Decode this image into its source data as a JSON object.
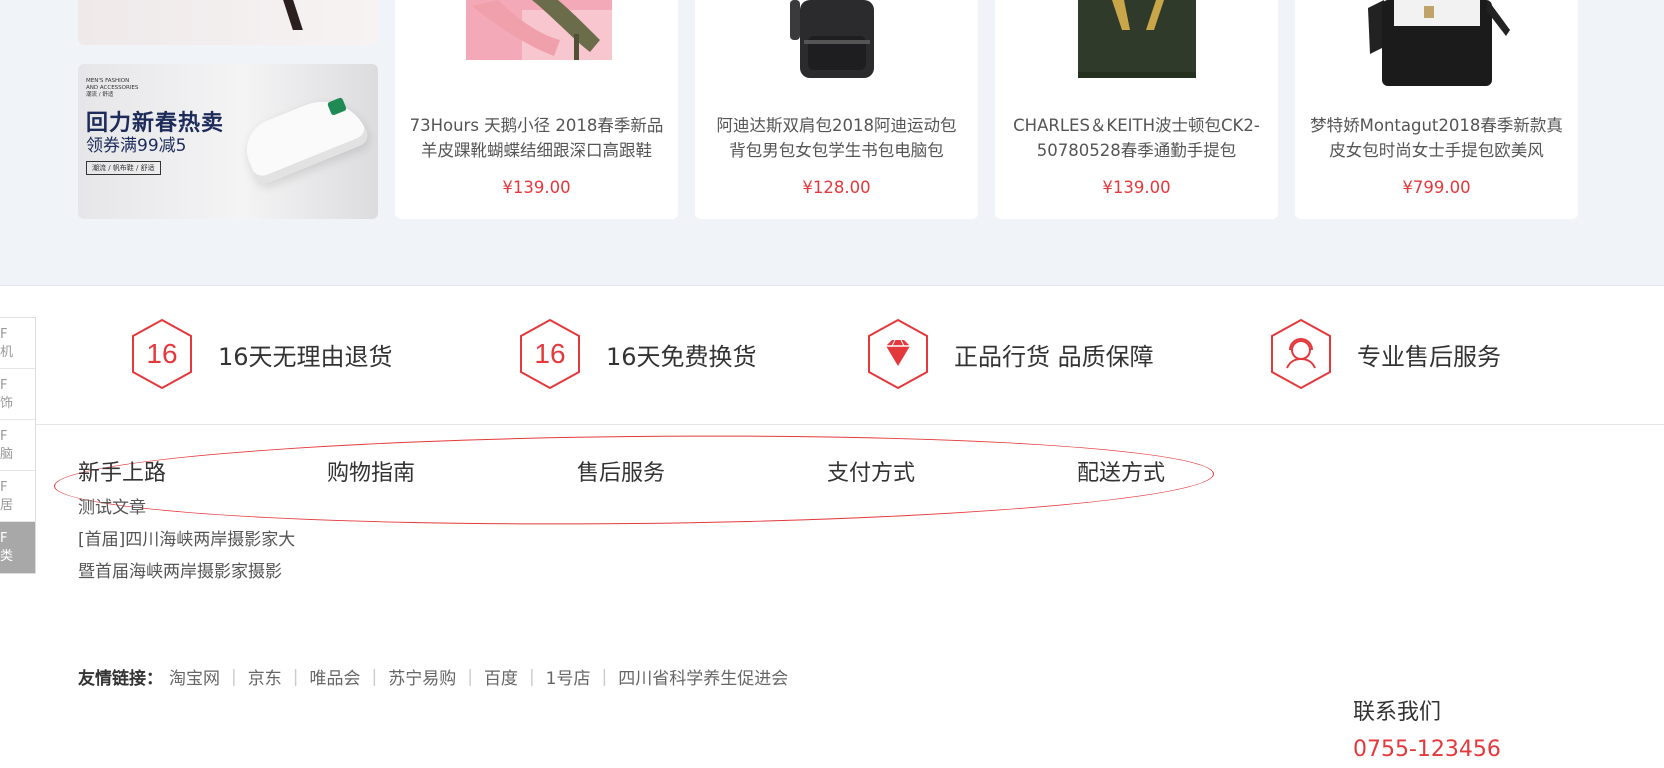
{
  "banner": {
    "tag_line1": "MEN'S FASHION",
    "tag_line2": "AND ACCESSORIES",
    "tag_line3": "潮流 / 舒适",
    "headline": "回力新春热卖",
    "subline": "领券满99减5",
    "pill": "潮流 / 帆布鞋 / 舒适"
  },
  "products": [
    {
      "title": "73Hours 天鹅小径 2018春季新品羊皮踝靴蝴蝶结细跟深口高跟鞋",
      "price": "¥139.00"
    },
    {
      "title": "阿迪达斯双肩包2018阿迪运动包背包男包女包学生书包电脑包",
      "price": "¥128.00"
    },
    {
      "title": "CHARLES＆KEITH波士顿包CK2-50780528春季通勤手提包",
      "price": "¥139.00"
    },
    {
      "title": "梦特娇Montagut2018春季新款真皮女包时尚女士手提包欧美风",
      "price": "¥799.00"
    }
  ],
  "services": [
    {
      "icon": "sixteen-icon",
      "badge": "16",
      "label": "16天无理由退货"
    },
    {
      "icon": "sixteen-icon",
      "badge": "16",
      "label": "16天免费换货"
    },
    {
      "icon": "diamond-icon",
      "badge": "",
      "label": "正品行货 品质保障"
    },
    {
      "icon": "support-agent-icon",
      "badge": "",
      "label": "专业售后服务"
    }
  ],
  "floor_nav": [
    {
      "line1": "F",
      "line2": "机"
    },
    {
      "line1": "F",
      "line2": "饰"
    },
    {
      "line1": "F",
      "line2": "脑"
    },
    {
      "line1": "F",
      "line2": "居"
    },
    {
      "line1": "F",
      "line2": "类"
    }
  ],
  "help": {
    "columns": [
      "新手上路",
      "购物指南",
      "售后服务",
      "支付方式",
      "配送方式"
    ],
    "articles": [
      "测试文章",
      "[首届]四川海峡两岸摄影家大",
      "暨首届海峡两岸摄影家摄影"
    ]
  },
  "links": {
    "label": "友情链接：",
    "items": [
      "淘宝网",
      "京东",
      "唯品会",
      "苏宁易购",
      "百度",
      "1号店",
      "四川省科学养生促进会"
    ]
  },
  "contact": {
    "title": "联系我们",
    "phone": "0755-123456"
  },
  "colors": {
    "accent": "#e4393c",
    "strip_bg": "#f0f3f8"
  }
}
